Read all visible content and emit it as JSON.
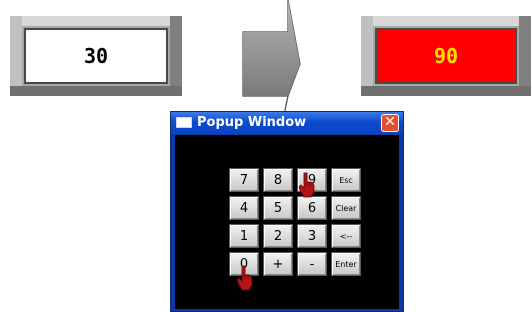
{
  "left_display": {
    "value": "30"
  },
  "right_display": {
    "value": "90"
  },
  "popup": {
    "title": "Popup Window",
    "close_label": "✕",
    "keys": [
      "7",
      "8",
      "9",
      "Esc",
      "4",
      "5",
      "6",
      "Clear",
      "1",
      "2",
      "3",
      "<--",
      "0",
      "+",
      "-",
      "Enter"
    ]
  },
  "colors": {
    "right_display_bg": "#ff0000",
    "right_display_text": "#ffe000",
    "titlebar": "#0d4ccd",
    "close_button": "#e3502f"
  },
  "icons": {
    "pointer": "hand-pointer-icon"
  }
}
